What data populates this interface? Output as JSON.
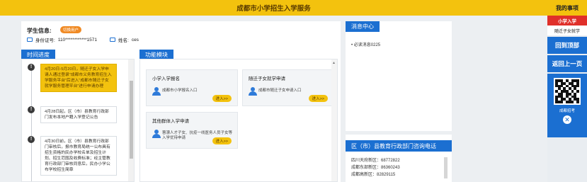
{
  "header": {
    "title": "成都市小学招生入学服务"
  },
  "side_panel": {
    "title": "我的事项",
    "items": [
      "小学入学",
      "随迁子女就学"
    ],
    "back_top": "回到顶部",
    "back_prev": "返回上一页",
    "qr_label": "成都招考",
    "close_glyph": "✕"
  },
  "student": {
    "label": "学生信息:",
    "switch_label": "切换用户",
    "id_label": "身份证号:",
    "id_value": "110************1571",
    "name_label": "姓名:",
    "name_value": "ces"
  },
  "timeline": {
    "title": "时间进度",
    "items": [
      {
        "text": "4月20日-5月20日，随迁子女入学申请人通过登录“成都市义务教育招生入学服务平台”后进入“成都市随迁子女就学服务管理平台”进行申请办理"
      },
      {
        "text": "4月28日起，区（市）县教育行政部门发布本地户籍入学登记公告"
      },
      {
        "text": "4月30日前，区（市）县教育行政部门审核后，报市教育局统一公布具有招生资格的民办学校名单及招生计划、招生范围及收费标准；经主管教育行政部门审核同意后，民办小学公布学校招生简章"
      }
    ]
  },
  "functions": {
    "title": "功能模块",
    "cards": [
      {
        "title": "小学入学报名",
        "desc": "成都市小学报名入口",
        "button": "进入>>"
      },
      {
        "title": "随迁子女就学申请",
        "desc": "成都市随迁子女申请入口",
        "button": "进入>>"
      },
      {
        "title": "其他群体入学申请",
        "desc": "蓉漂人才子女、抗疫一线医务人员子女等入学优待申请",
        "button": "进入>>"
      }
    ]
  },
  "messages": {
    "title": "消息中心",
    "items": [
      "必读消息0225"
    ]
  },
  "hotline": {
    "title": "区（市）县教育行政部门咨询电话",
    "items": [
      "四川天府新区：68772822",
      "成都东部新区：86360243",
      "成都高新区：82829115"
    ]
  }
}
